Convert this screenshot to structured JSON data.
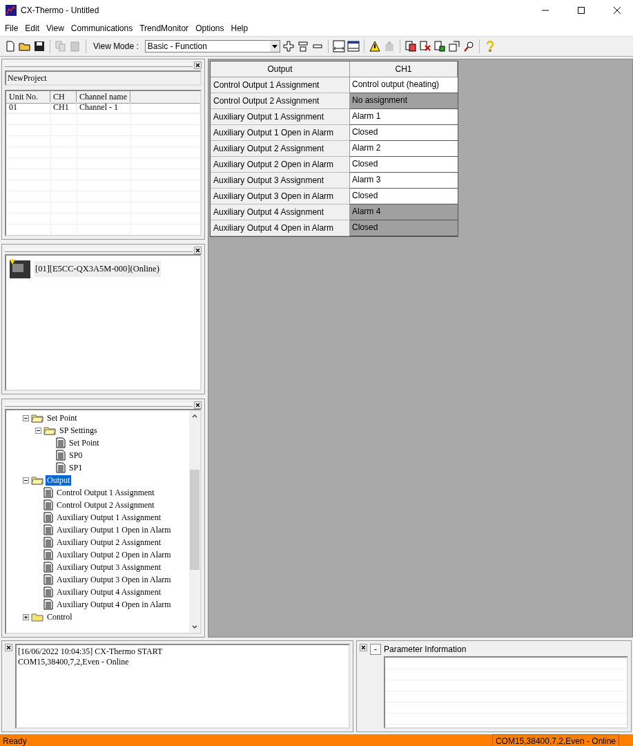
{
  "window": {
    "title": "CX-Thermo - Untitled"
  },
  "menu": [
    "File",
    "Edit",
    "View",
    "Communications",
    "TrendMonitor",
    "Options",
    "Help"
  ],
  "toolbar": {
    "view_mode_label": "View Mode :",
    "view_mode_value": "Basic - Function"
  },
  "project_panel": {
    "project_name": "NewProject",
    "columns": [
      "Unit No.",
      "CH",
      "Channel name"
    ],
    "rows": [
      [
        "01",
        "CH1",
        "Channel - 1"
      ]
    ]
  },
  "device_panel": {
    "device": "[01][E5CC-QX3A5M-000](Online)"
  },
  "tree": [
    {
      "label": "Set Point",
      "kind": "folder",
      "expanded": true,
      "selected": false,
      "children": [
        {
          "label": "SP Settings",
          "kind": "folder",
          "expanded": true,
          "selected": false,
          "children": [
            {
              "label": "Set Point",
              "kind": "param",
              "selected": false
            },
            {
              "label": "SP0",
              "kind": "param",
              "selected": false
            },
            {
              "label": "SP1",
              "kind": "param",
              "selected": false
            }
          ]
        }
      ]
    },
    {
      "label": "Output",
      "kind": "folder",
      "expanded": true,
      "selected": true,
      "children": [
        {
          "label": "Control Output 1 Assignment",
          "kind": "param",
          "selected": false
        },
        {
          "label": "Control Output 2 Assignment",
          "kind": "param",
          "selected": false
        },
        {
          "label": "Auxiliary Output 1 Assignment",
          "kind": "param",
          "selected": false
        },
        {
          "label": "Auxiliary Output 1 Open in Alarm",
          "kind": "param",
          "selected": false
        },
        {
          "label": "Auxiliary Output 2 Assignment",
          "kind": "param",
          "selected": false
        },
        {
          "label": "Auxiliary Output 2 Open in Alarm",
          "kind": "param",
          "selected": false
        },
        {
          "label": "Auxiliary Output 3 Assignment",
          "kind": "param",
          "selected": false
        },
        {
          "label": "Auxiliary Output 3 Open in Alarm",
          "kind": "param",
          "selected": false
        },
        {
          "label": "Auxiliary Output 4 Assignment",
          "kind": "param",
          "selected": false
        },
        {
          "label": "Auxiliary Output 4 Open in Alarm",
          "kind": "param",
          "selected": false
        }
      ]
    },
    {
      "label": "Control",
      "kind": "folder",
      "expanded": false,
      "selected": false
    }
  ],
  "grid": {
    "columns": [
      "Output",
      "CH1"
    ],
    "rows": [
      {
        "label": "Control Output 1 Assignment",
        "value": "Control output (heating)",
        "disabled": false
      },
      {
        "label": "Control Output 2 Assignment",
        "value": "No assignment",
        "disabled": true
      },
      {
        "label": "Auxiliary Output 1 Assignment",
        "value": "Alarm 1",
        "disabled": false
      },
      {
        "label": "Auxiliary Output 1 Open in Alarm",
        "value": "Closed",
        "disabled": false
      },
      {
        "label": "Auxiliary Output 2 Assignment",
        "value": "Alarm 2",
        "disabled": false
      },
      {
        "label": "Auxiliary Output 2 Open in Alarm",
        "value": "Closed",
        "disabled": false
      },
      {
        "label": "Auxiliary Output 3 Assignment",
        "value": "Alarm 3",
        "disabled": false
      },
      {
        "label": "Auxiliary Output 3 Open in Alarm",
        "value": "Closed",
        "disabled": false
      },
      {
        "label": "Auxiliary Output 4 Assignment",
        "value": "Alarm 4",
        "disabled": true
      },
      {
        "label": "Auxiliary Output 4 Open in Alarm",
        "value": "Closed",
        "disabled": true
      }
    ]
  },
  "log": {
    "lines": [
      "[16/06/2022 10:04:35] CX-Thermo START",
      "COM15,38400,7,2,Even - Online"
    ]
  },
  "parameter_info": {
    "toggle": "-",
    "title": "Parameter Information"
  },
  "status_bar": {
    "left": "Ready",
    "right": "COM15,38400,7,2,Even - Online"
  }
}
